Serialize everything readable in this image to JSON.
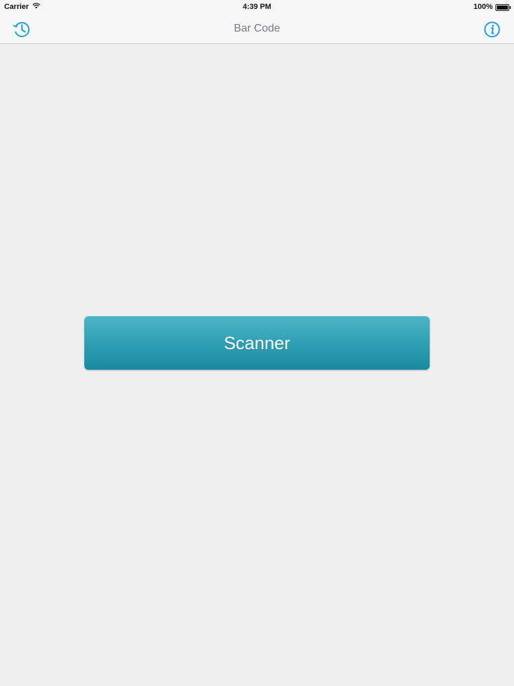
{
  "status_bar": {
    "carrier": "Carrier",
    "time": "4:39 PM",
    "battery": "100%"
  },
  "nav_bar": {
    "title": "Bar Code",
    "left_icon": "history-clock-icon",
    "right_icon": "info-icon"
  },
  "main": {
    "scanner_label": "Scanner"
  },
  "colors": {
    "accent": "#1a9fe0",
    "button_top": "#4cb5c8",
    "button_bottom": "#1c8a9e",
    "background": "#efeff0"
  }
}
